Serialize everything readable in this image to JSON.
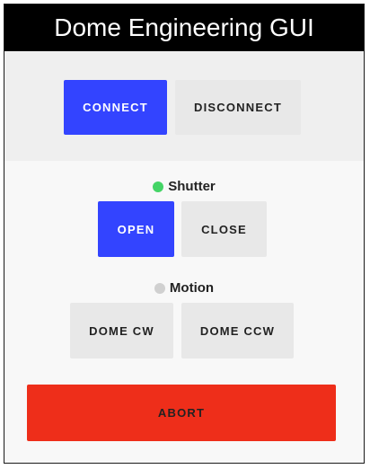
{
  "window": {
    "title": "Dome Engineering GUI"
  },
  "connection": {
    "connect_label": "CONNECT",
    "disconnect_label": "DISCONNECT"
  },
  "shutter": {
    "label": "Shutter",
    "status_color": "#44d466",
    "open_label": "OPEN",
    "close_label": "CLOSE"
  },
  "motion": {
    "label": "Motion",
    "status_color": "#d0d0d0",
    "cw_label": "DOME CW",
    "ccw_label": "DOME CCW"
  },
  "abort": {
    "label": "ABORT"
  },
  "colors": {
    "primary": "#3344ff",
    "danger": "#ee2e1a",
    "default_button": "#e8e8e8"
  }
}
